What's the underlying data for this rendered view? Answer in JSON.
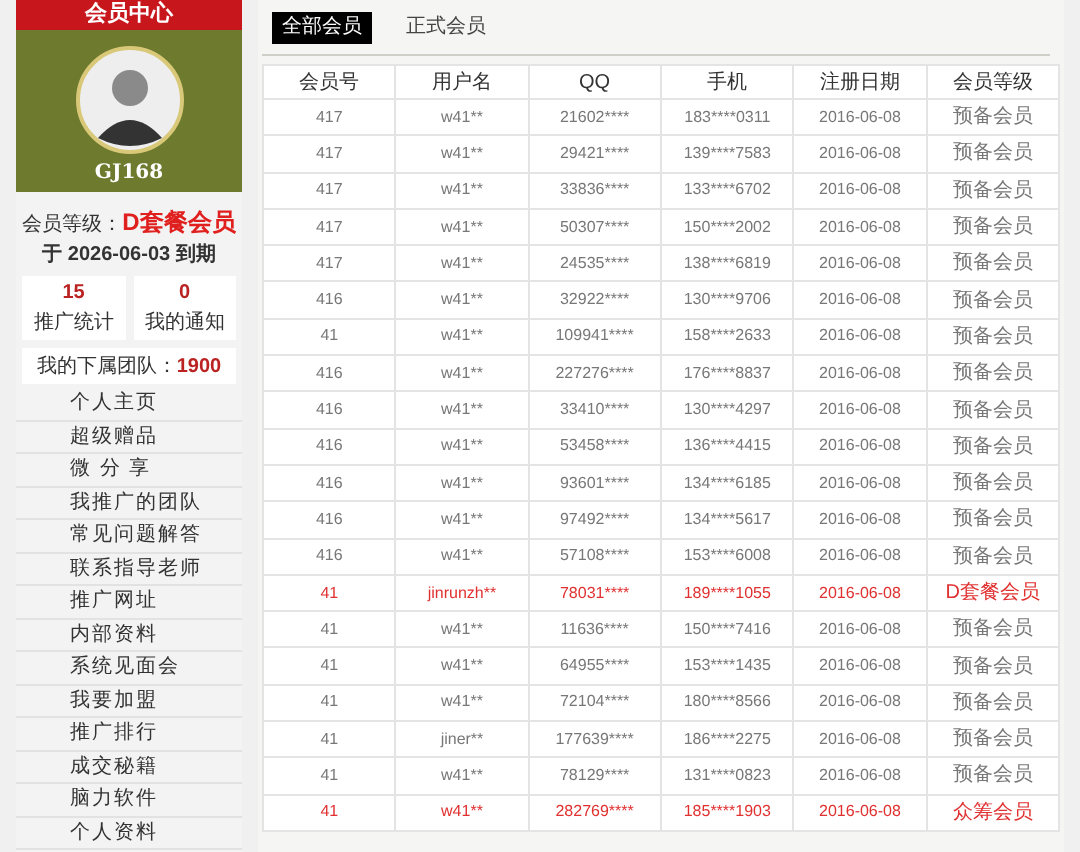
{
  "sidebar": {
    "title": "会员中心",
    "username": "GJ168",
    "level_label": "会员等级：",
    "level_value": "D套餐会员",
    "expiry": "于 2026-06-03 到期",
    "stats": [
      {
        "value": "15",
        "label": "推广统计"
      },
      {
        "value": "0",
        "label": "我的通知"
      }
    ],
    "team_label": "我的下属团队：",
    "team_value": "1900",
    "menu": [
      "个人主页",
      "超级赠品",
      "微 分 享",
      "我推广的团队",
      "常见问题解答",
      "联系指导老师",
      "推广网址",
      "内部资料",
      "系统见面会",
      "我要加盟",
      "推广排行",
      "成交秘籍",
      "脑力软件",
      "个人资料"
    ]
  },
  "tabs": [
    {
      "label": "全部会员",
      "selected": true
    },
    {
      "label": "正式会员",
      "selected": false
    }
  ],
  "table": {
    "columns": [
      "会员号",
      "用户名",
      "QQ",
      "手机",
      "注册日期",
      "会员等级"
    ],
    "rows": [
      {
        "highlight": false,
        "cells": [
          "417",
          "w41**",
          "21602****",
          "183****0311",
          "2016-06-08",
          "预备会员"
        ]
      },
      {
        "highlight": false,
        "cells": [
          "417",
          "w41**",
          "29421****",
          "139****7583",
          "2016-06-08",
          "预备会员"
        ]
      },
      {
        "highlight": false,
        "cells": [
          "417",
          "w41**",
          "33836****",
          "133****6702",
          "2016-06-08",
          "预备会员"
        ]
      },
      {
        "highlight": false,
        "cells": [
          "417",
          "w41**",
          "50307****",
          "150****2002",
          "2016-06-08",
          "预备会员"
        ]
      },
      {
        "highlight": false,
        "cells": [
          "417",
          "w41**",
          "24535****",
          "138****6819",
          "2016-06-08",
          "预备会员"
        ]
      },
      {
        "highlight": false,
        "cells": [
          "416",
          "w41**",
          "32922****",
          "130****9706",
          "2016-06-08",
          "预备会员"
        ]
      },
      {
        "highlight": false,
        "cells": [
          "41",
          "w41**",
          "109941****",
          "158****2633",
          "2016-06-08",
          "预备会员"
        ]
      },
      {
        "highlight": false,
        "cells": [
          "416",
          "w41**",
          "227276****",
          "176****8837",
          "2016-06-08",
          "预备会员"
        ]
      },
      {
        "highlight": false,
        "cells": [
          "416",
          "w41**",
          "33410****",
          "130****4297",
          "2016-06-08",
          "预备会员"
        ]
      },
      {
        "highlight": false,
        "cells": [
          "416",
          "w41**",
          "53458****",
          "136****4415",
          "2016-06-08",
          "预备会员"
        ]
      },
      {
        "highlight": false,
        "cells": [
          "416",
          "w41**",
          "93601****",
          "134****6185",
          "2016-06-08",
          "预备会员"
        ]
      },
      {
        "highlight": false,
        "cells": [
          "416",
          "w41**",
          "97492****",
          "134****5617",
          "2016-06-08",
          "预备会员"
        ]
      },
      {
        "highlight": false,
        "cells": [
          "416",
          "w41**",
          "57108****",
          "153****6008",
          "2016-06-08",
          "预备会员"
        ]
      },
      {
        "highlight": true,
        "cells": [
          "41",
          "jinrunzh**",
          "78031****",
          "189****1055",
          "2016-06-08",
          "D套餐会员"
        ]
      },
      {
        "highlight": false,
        "cells": [
          "41",
          "w41**",
          "11636****",
          "150****7416",
          "2016-06-08",
          "预备会员"
        ]
      },
      {
        "highlight": false,
        "cells": [
          "41",
          "w41**",
          "64955****",
          "153****1435",
          "2016-06-08",
          "预备会员"
        ]
      },
      {
        "highlight": false,
        "cells": [
          "41",
          "w41**",
          "72104****",
          "180****8566",
          "2016-06-08",
          "预备会员"
        ]
      },
      {
        "highlight": false,
        "cells": [
          "41",
          "jiner**",
          "177639****",
          "186****2275",
          "2016-06-08",
          "预备会员"
        ]
      },
      {
        "highlight": false,
        "cells": [
          "41",
          "w41**",
          "78129****",
          "131****0823",
          "2016-06-08",
          "预备会员"
        ]
      },
      {
        "highlight": true,
        "cells": [
          "41",
          "w41**",
          "282769****",
          "185****1903",
          "2016-06-08",
          "众筹会员"
        ]
      }
    ]
  }
}
